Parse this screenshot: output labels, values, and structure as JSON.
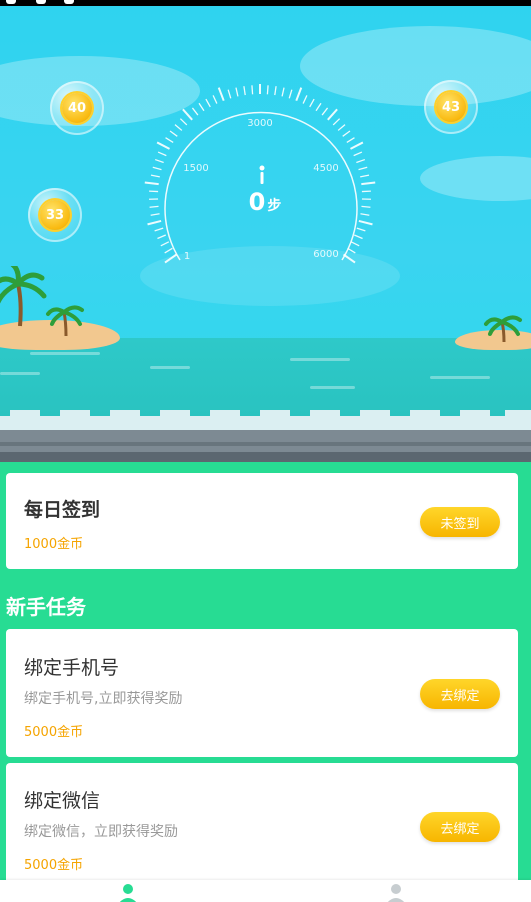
{
  "hero": {
    "gauge": {
      "ticks": [
        "1",
        "1500",
        "3000",
        "4500",
        "6000"
      ],
      "steps_value": "0",
      "steps_unit": "步"
    },
    "coins": [
      {
        "value": "40"
      },
      {
        "value": "43"
      },
      {
        "value": "33"
      }
    ]
  },
  "daily_checkin": {
    "title": "每日签到",
    "reward": "1000金币",
    "button_label": "未签到"
  },
  "newbie_tasks": {
    "section_title": "新手任务",
    "items": [
      {
        "title": "绑定手机号",
        "desc": "绑定手机号,立即获得奖励",
        "reward": "5000金币",
        "button_label": "去绑定"
      },
      {
        "title": "绑定微信",
        "desc": "绑定微信，立即获得奖励",
        "reward": "5000金币",
        "button_label": "去绑定"
      }
    ]
  },
  "tabbar": {
    "tabs": [
      {
        "icon": "person-icon",
        "active": true,
        "color": "#27dc93"
      },
      {
        "icon": "person-icon",
        "active": false,
        "color": "#c7cdd0"
      }
    ]
  }
}
